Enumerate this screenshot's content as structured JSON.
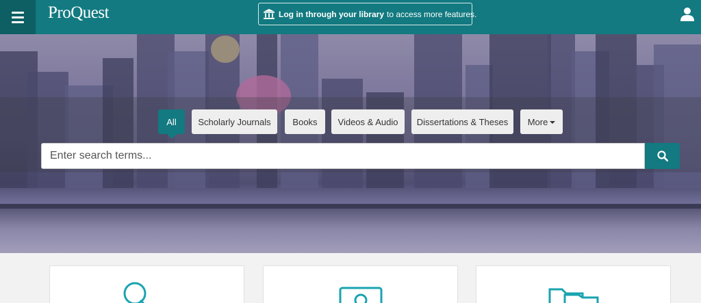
{
  "header": {
    "logo_text": "ProQuest",
    "login_bold": "Log in through your library",
    "login_rest": "to access more features.",
    "menu_icon": "hamburger-menu-icon",
    "library_icon": "library-building-icon",
    "user_icon": "user-icon"
  },
  "search": {
    "tabs": [
      {
        "label": "All",
        "active": true
      },
      {
        "label": "Scholarly Journals",
        "active": false
      },
      {
        "label": "Books",
        "active": false
      },
      {
        "label": "Videos & Audio",
        "active": false
      },
      {
        "label": "Dissertations & Theses",
        "active": false
      },
      {
        "label": "More",
        "active": false
      }
    ],
    "placeholder": "Enter search terms...",
    "button_icon": "search-icon"
  },
  "cards": [
    {
      "icon": "magnifier-q-icon"
    },
    {
      "icon": "profile-card-icon"
    },
    {
      "icon": "folders-icon"
    }
  ],
  "colors": {
    "brand": "#127a80",
    "brand_dark": "#0d5f64"
  }
}
